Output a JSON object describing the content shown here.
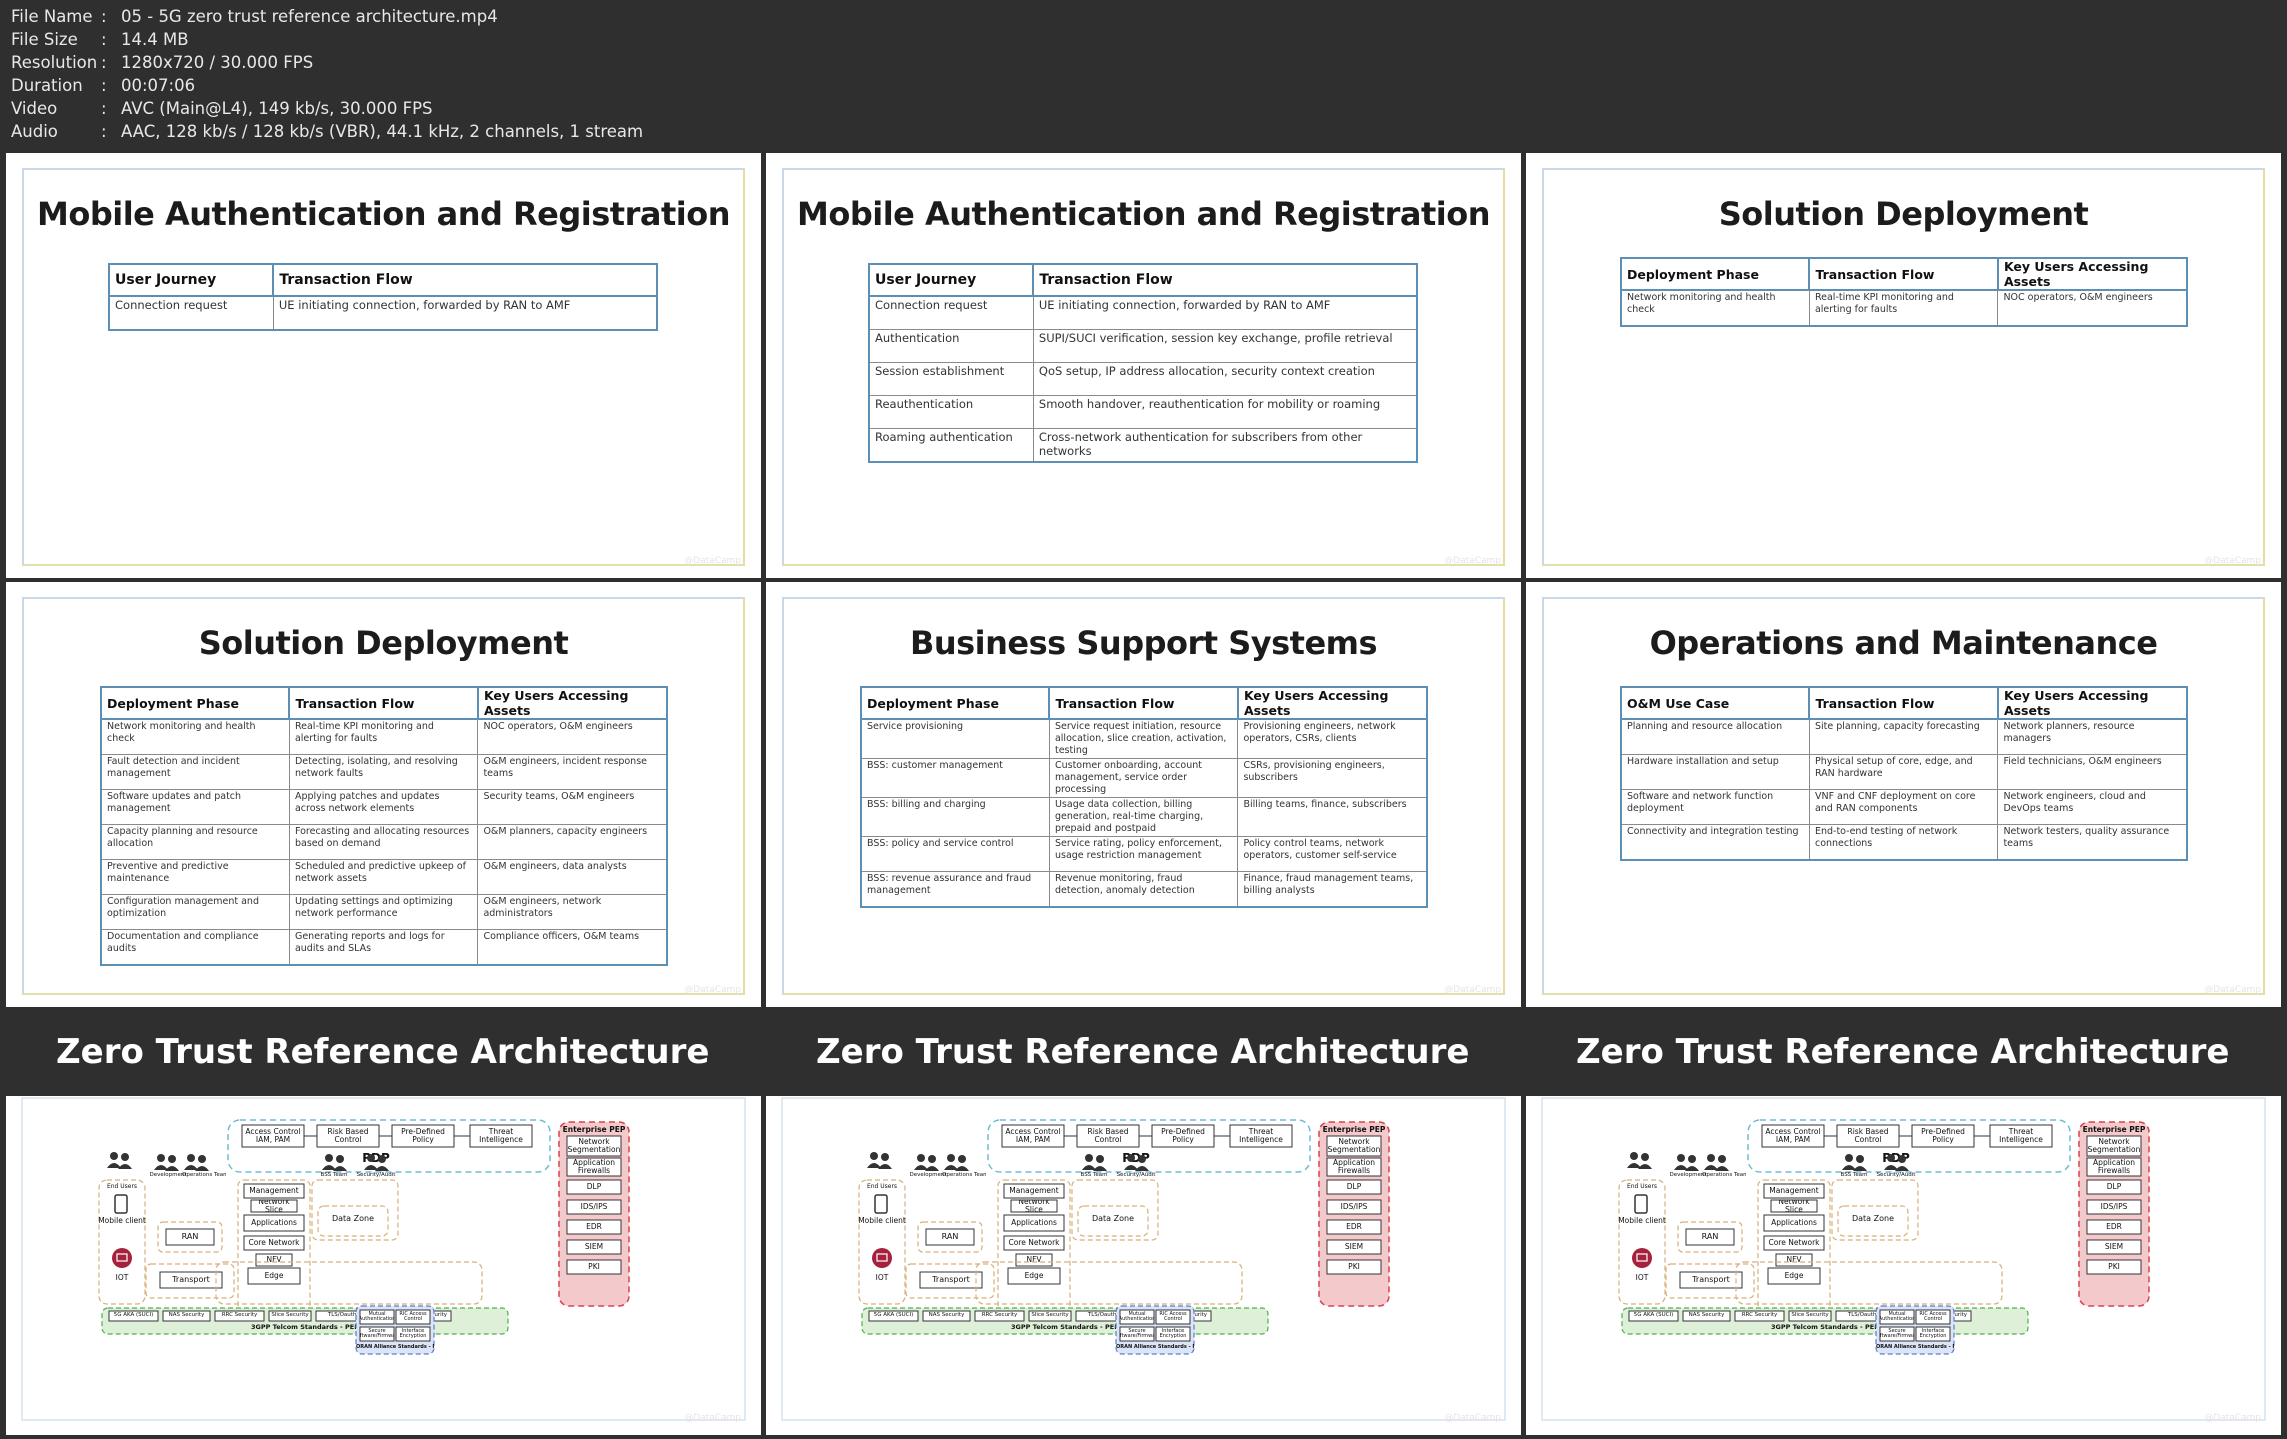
{
  "meta": [
    {
      "label": "File Name",
      "value": "05 - 5G zero trust reference architecture.mp4"
    },
    {
      "label": "File Size",
      "value": "14.4 MB"
    },
    {
      "label": "Resolution",
      "value": "1280x720 / 30.000 FPS"
    },
    {
      "label": "Duration",
      "value": "00:07:06"
    },
    {
      "label": "Video",
      "value": "AVC (Main@L4), 149 kb/s, 30.000 FPS"
    },
    {
      "label": "Audio",
      "value": "AAC, 128 kb/s / 128 kb/s (VBR), 44.1 kHz, 2 channels, 1 stream"
    }
  ],
  "meta_separator": ":",
  "watermark": "@DataCamp",
  "panels": {
    "p1": {
      "title": "Mobile Authentication and Registration",
      "headers": [
        "User Journey",
        "Transaction Flow"
      ],
      "rows": [
        [
          "Connection request",
          "UE initiating connection, forwarded by RAN to AMF"
        ]
      ]
    },
    "p2": {
      "title": "Mobile Authentication and Registration",
      "headers": [
        "User Journey",
        "Transaction Flow"
      ],
      "rows": [
        [
          "Connection request",
          "UE initiating connection, forwarded by RAN to AMF"
        ],
        [
          "Authentication",
          "SUPI/SUCI verification, session key exchange, profile retrieval"
        ],
        [
          "Session establishment",
          "QoS setup, IP address allocation, security context creation"
        ],
        [
          "Reauthentication",
          "Smooth handover, reauthentication for mobility or roaming"
        ],
        [
          "Roaming authentication",
          "Cross-network authentication for subscribers from other networks"
        ]
      ]
    },
    "p3": {
      "title": "Solution Deployment",
      "headers": [
        "Deployment Phase",
        "Transaction Flow",
        "Key Users Accessing Assets"
      ],
      "rows": [
        [
          "Network monitoring and health check",
          "Real-time KPI monitoring and alerting for faults",
          "NOC operators, O&M engineers"
        ]
      ]
    },
    "p4": {
      "title": "Solution Deployment",
      "headers": [
        "Deployment Phase",
        "Transaction Flow",
        "Key Users Accessing Assets"
      ],
      "rows": [
        [
          "Network monitoring and health check",
          "Real-time KPI monitoring and alerting for faults",
          "NOC operators, O&M engineers"
        ],
        [
          "Fault detection and incident management",
          "Detecting, isolating, and resolving network faults",
          "O&M engineers, incident response teams"
        ],
        [
          "Software updates and patch management",
          "Applying patches and updates across network elements",
          "Security teams, O&M engineers"
        ],
        [
          "Capacity planning and resource allocation",
          "Forecasting and allocating resources based on demand",
          "O&M planners, capacity engineers"
        ],
        [
          "Preventive and predictive maintenance",
          "Scheduled and predictive upkeep of network assets",
          "O&M engineers, data analysts"
        ],
        [
          "Configuration management and optimization",
          "Updating settings and optimizing network performance",
          "O&M engineers, network administrators"
        ],
        [
          "Documentation and compliance audits",
          "Generating reports and logs for audits and SLAs",
          "Compliance officers, O&M teams"
        ]
      ]
    },
    "p5": {
      "title": "Business Support Systems",
      "headers": [
        "Deployment Phase",
        "Transaction Flow",
        "Key Users Accessing Assets"
      ],
      "rows": [
        [
          "Service provisioning",
          "Service request initiation, resource allocation, slice creation, activation, testing",
          "Provisioning engineers, network operators, CSRs, clients"
        ],
        [
          "BSS: customer management",
          "Customer onboarding, account management, service order processing",
          "CSRs, provisioning engineers, subscribers"
        ],
        [
          "BSS: billing and charging",
          "Usage data collection, billing generation, real-time charging, prepaid and postpaid",
          "Billing teams, finance, subscribers"
        ],
        [
          "BSS: policy and service control",
          "Service rating, policy enforcement, usage restriction management",
          "Policy control teams, network operators, customer self-service"
        ],
        [
          "BSS: revenue assurance and fraud management",
          "Revenue monitoring, fraud detection, anomaly detection",
          "Finance, fraud management teams, billing analysts"
        ]
      ]
    },
    "p6": {
      "title": "Operations and Maintenance",
      "headers": [
        "O&M Use Case",
        "Transaction Flow",
        "Key Users Accessing Assets"
      ],
      "rows": [
        [
          "Planning and resource allocation",
          "Site planning, capacity forecasting",
          "Network planners, resource managers"
        ],
        [
          "Hardware installation and setup",
          "Physical setup of core, edge, and RAN hardware",
          "Field technicians, O&M engineers"
        ],
        [
          "Software and network function deployment",
          "VNF and CNF deployment on core and RAN components",
          "Network engineers, cloud and DevOps teams"
        ],
        [
          "Connectivity and integration testing",
          "End-to-end testing of network connections",
          "Network testers, quality assurance teams"
        ]
      ]
    }
  },
  "architecture": {
    "title": "Zero Trust Reference Architecture",
    "pdp_label": "PDP",
    "pdp_items": [
      "Access Control IAM, PAM",
      "Risk Based Control",
      "Pre-Defined Policy",
      "Threat Intelligence"
    ],
    "enterprise_pep_title": "Enterprise PEP",
    "enterprise_pep_items": [
      "Network Segmentation",
      "Application Firewalls",
      "DLP",
      "IDS/IPS",
      "EDR",
      "SIEM",
      "PKI"
    ],
    "end_users_label": "End Users",
    "mobile_client_label": "Mobile client",
    "iot_label": "IOT",
    "team_labels": [
      "Development",
      "Operations Team",
      "BSS Team",
      "Security/Audit"
    ],
    "core_items": [
      "Management",
      "Network Slice",
      "Applications",
      "Core Network",
      "NFV",
      "Edge"
    ],
    "ran_label": "RAN",
    "transport_label": "Transport",
    "data_zone_label": "Data Zone",
    "standards_items": [
      "5G AKA (SUCI)",
      "NAS Security",
      "RRC Security",
      "Slice Security",
      "TLS/Oauth2.0",
      "IPSEC",
      "API Security"
    ],
    "standards_caption": "3GPP Telcom Standards - PEP",
    "oran_items": [
      "Mutual Authentication",
      "RIC Access Control",
      "Secure Software/Firmware",
      "Interface Encryption"
    ],
    "oran_caption": "ORAN Alliance Standards - PEP"
  }
}
